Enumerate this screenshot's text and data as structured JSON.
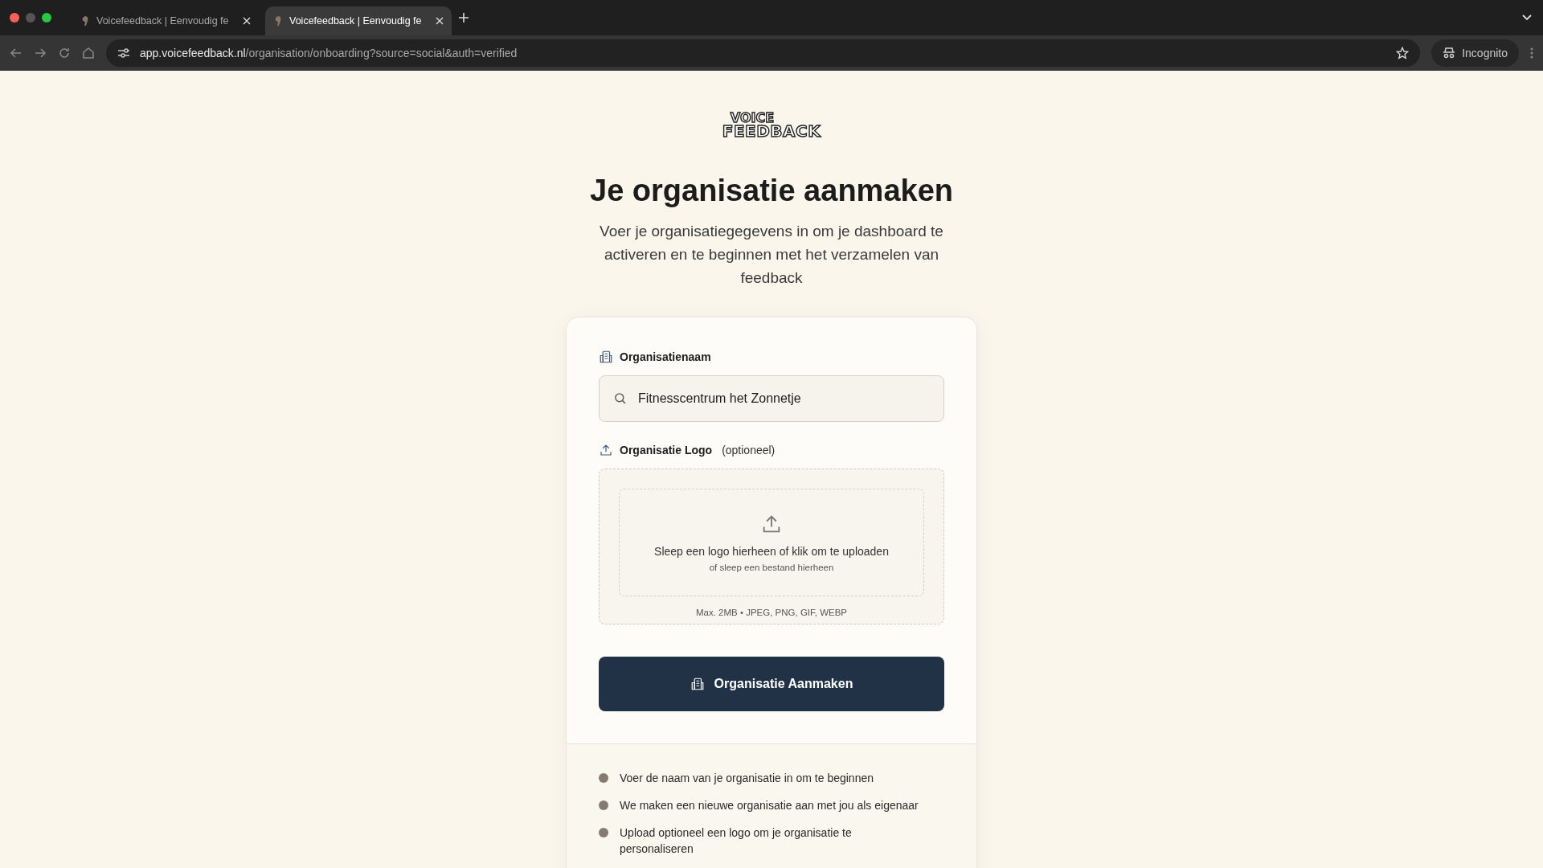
{
  "browser": {
    "tabs": [
      {
        "title": "Voicefeedback | Eenvoudig fe",
        "selected": false
      },
      {
        "title": "Voicefeedback | Eenvoudig fe",
        "selected": true
      }
    ],
    "url_host": "app.voicefeedback.nl",
    "url_path": "/organisation/onboarding?source=social&auth=verified",
    "profile": "Incognito"
  },
  "logo": {
    "line_1": "VOICE",
    "line_2": "FEEDBACK"
  },
  "title": "Je organisatie aanmaken",
  "subtitle": "Voer je organisatiegegevens in om je dashboard te activeren en te beginnen met het verzamelen van feedback",
  "form": {
    "name_label": "Organisatienaam",
    "name_value": "Fitnesscentrum het Zonnetje",
    "logo_label": "Organisatie Logo",
    "logo_optional": "(optioneel)",
    "drop_main": "Sleep een logo hierheen of klik om te uploaden",
    "drop_sub": "of sleep een bestand hierheen",
    "drop_limits": "Max. 2MB • JPEG, PNG, GIF, WEBP",
    "submit": "Organisatie Aanmaken"
  },
  "steps": [
    "Voer de naam van je organisatie in om te beginnen",
    "We maken een nieuwe organisatie aan met jou als eigenaar",
    "Upload optioneel een logo om je organisatie te personaliseren"
  ]
}
